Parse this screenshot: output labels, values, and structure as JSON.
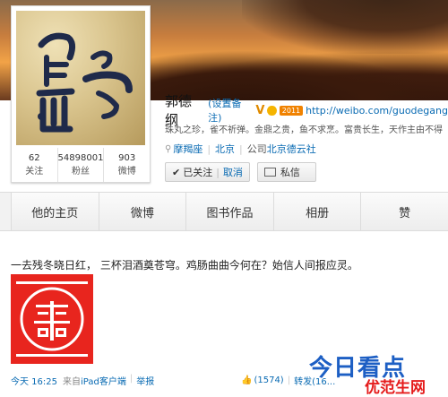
{
  "profile": {
    "name": "郭德纲",
    "remark_link": "(设置备注)",
    "verified_mark": "V",
    "vip_label": "2011",
    "url": "http://weibo.com/guodegang",
    "motto": "珠丸之珍，雀不祈弹。金鼎之贵，鱼不求烹。富贵长生，天作主由不得",
    "zodiac": "摩羯座",
    "location": "北京",
    "company_prefix": "公司",
    "company": "北京德云社",
    "stats": [
      {
        "num": "62",
        "label": "关注"
      },
      {
        "num": "54898001",
        "label": "粉丝"
      },
      {
        "num": "903",
        "label": "微博"
      }
    ],
    "followed_label": "已关注",
    "cancel_label": "取消",
    "message_label": "私信"
  },
  "tabs": [
    "他的主页",
    "微博",
    "图书作品",
    "相册",
    "赞"
  ],
  "post": {
    "text": "一去残冬晓日红， 三杯泪酒奠苍穹。鸡肠曲曲今何在？始信人间报应灵。",
    "time": "今天 16:25",
    "source_prefix": "来自",
    "source": "iPad客户端",
    "report": "举报",
    "likes": "(1574)",
    "repost": "转发(16..."
  },
  "watermark": {
    "main": "今日看点",
    "sub": "优范生网"
  },
  "colors": {
    "link": "#0a6bb3",
    "accent_orange": "#f08200",
    "banner": "#f2a347"
  }
}
